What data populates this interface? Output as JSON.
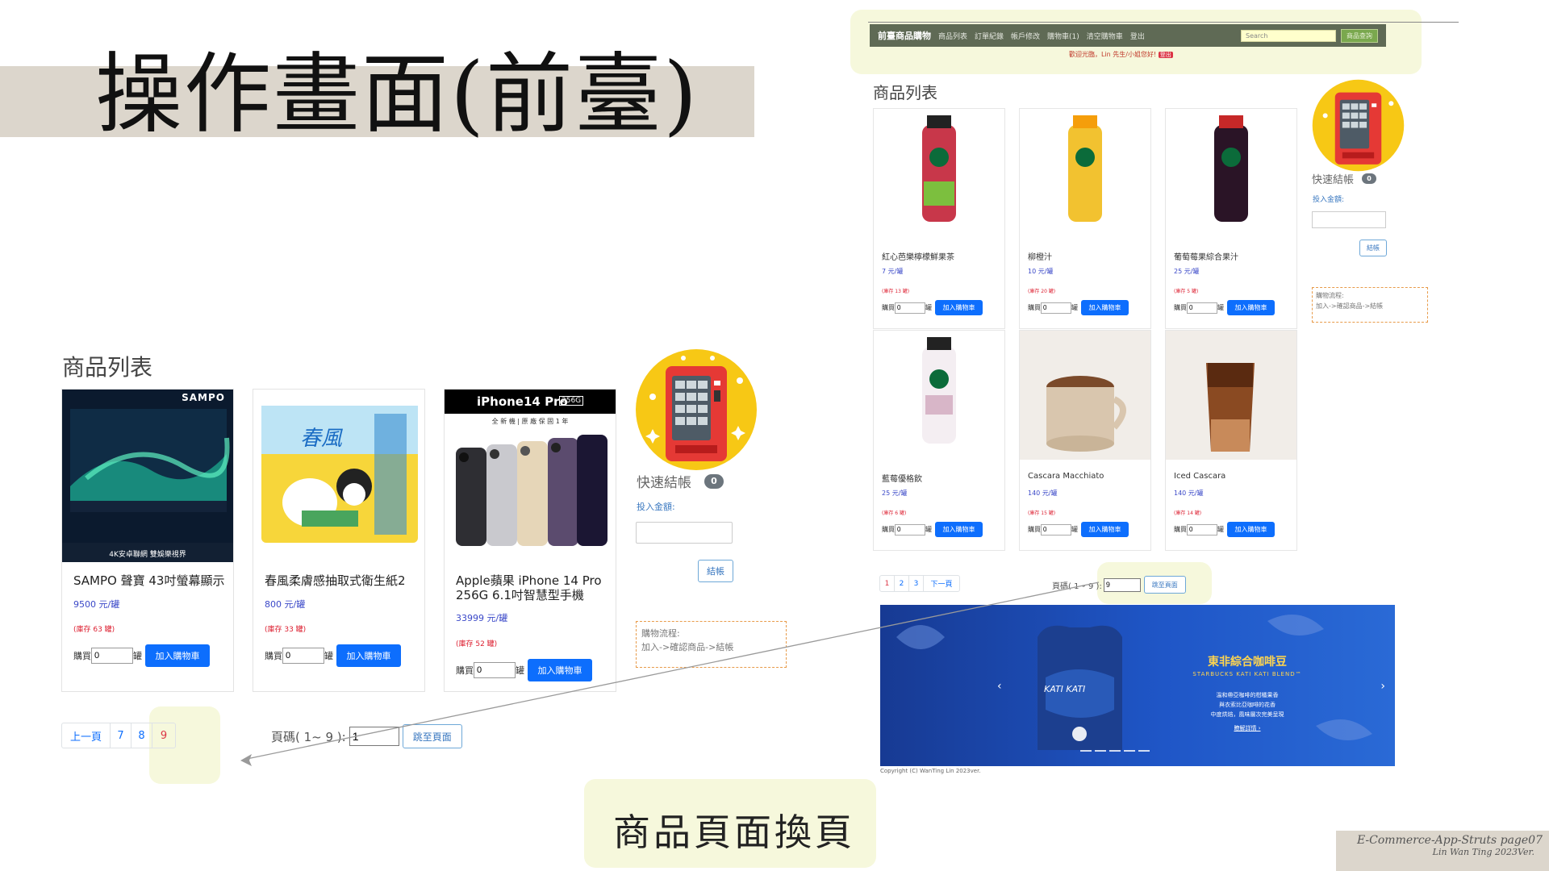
{
  "slide": {
    "title": "操作畫面(前臺)",
    "caption": "商品頁面換頁",
    "footer_line1": "E-Commerce-App-Struts page07",
    "footer_line2": "Lin Wan Ting 2023Ver."
  },
  "left_panel": {
    "section_title": "商品列表",
    "products": [
      {
        "name": "SAMPO 聲寶 43吋螢幕顯示",
        "price": "9500 元/罐",
        "stock": "(庫存 63 罐)",
        "buy_label": "購買",
        "qty": "0",
        "unit": "罐",
        "add_button": "加入購物車",
        "image_brand": "SAMPO",
        "image_caption": "4K安卓聯網 雙娛樂視界"
      },
      {
        "name": "春風柔膚感抽取式衛生紙2",
        "price": "800 元/罐",
        "stock": "(庫存 33 罐)",
        "buy_label": "購買",
        "qty": "0",
        "unit": "罐",
        "add_button": "加入購物車",
        "image_brand": "春風"
      },
      {
        "name": "Apple蘋果 iPhone 14 Pro 256G 6.1吋智慧型手機",
        "price": "33999 元/罐",
        "stock": "(庫存 52 罐)",
        "buy_label": "購買",
        "qty": "0",
        "unit": "罐",
        "add_button": "加入購物車",
        "image_brand": "iPhone14 Pro",
        "image_badge": "256G",
        "image_caption": "全 新 機 | 原 廠 保 固 1 年"
      }
    ],
    "quick_checkout": {
      "title": "快速結帳",
      "badge": "0",
      "amount_label": "投入金額:",
      "amount_value": "",
      "checkout_button": "結帳"
    },
    "flow": {
      "label": "購物流程:",
      "steps": "加入->確認商品->結帳"
    },
    "pagination": {
      "prev": "上一頁",
      "pages": [
        "7",
        "8",
        "9"
      ],
      "active": "9"
    },
    "jump": {
      "label": "頁碼( 1~ 9 ):",
      "value": "1",
      "button": "跳至頁面"
    }
  },
  "right_panel": {
    "navbar": {
      "brand": "前臺商品購物",
      "items": [
        "商品列表",
        "訂單紀錄",
        "帳戶修改",
        "購物車(1)",
        "清空購物車",
        "登出"
      ],
      "search_placeholder": "Search",
      "search_button": "商品查詢"
    },
    "welcome": "歡迎光臨，Lin 先生/小姐您好!",
    "logout": "登出",
    "section_title": "商品列表",
    "products": [
      {
        "name": "紅心芭樂檸檬鮮果茶",
        "price": "7 元/罐",
        "stock": "(庫存 13 罐)",
        "buy_label": "購買",
        "qty": "0",
        "unit": "罐",
        "add_button": "加入購物車"
      },
      {
        "name": "柳橙汁",
        "price": "10 元/罐",
        "stock": "(庫存 20 罐)",
        "buy_label": "購買",
        "qty": "0",
        "unit": "罐",
        "add_button": "加入購物車"
      },
      {
        "name": "葡萄莓果綜合果汁",
        "price": "25 元/罐",
        "stock": "(庫存 5 罐)",
        "buy_label": "購買",
        "qty": "0",
        "unit": "罐",
        "add_button": "加入購物車"
      },
      {
        "name": "藍莓優格飲",
        "price": "25 元/罐",
        "stock": "(庫存 6 罐)",
        "buy_label": "購買",
        "qty": "0",
        "unit": "罐",
        "add_button": "加入購物車"
      },
      {
        "name": "Cascara Macchiato",
        "price": "140 元/罐",
        "stock": "(庫存 15 罐)",
        "buy_label": "購買",
        "qty": "0",
        "unit": "罐",
        "add_button": "加入購物車"
      },
      {
        "name": "Iced Cascara",
        "price": "140 元/罐",
        "stock": "(庫存 14 罐)",
        "buy_label": "購買",
        "qty": "0",
        "unit": "罐",
        "add_button": "加入購物車"
      }
    ],
    "quick_checkout": {
      "title": "快速結帳",
      "badge": "0",
      "amount_label": "投入金額:",
      "checkout_button": "結帳"
    },
    "flow": {
      "label": "購物流程:",
      "steps": "加入->確認商品->結帳"
    },
    "pagination": {
      "pages": [
        "1",
        "2",
        "3"
      ],
      "active": "1",
      "next": "下一頁"
    },
    "jump": {
      "label": "頁碼( 1~ 9 ):",
      "value": "9",
      "button": "跳至頁面"
    },
    "banner": {
      "title": "東非綜合咖啡豆",
      "subtitle": "STARBUCKS KATI KATI BLEND™",
      "line1": "溫和帶亞咖啡的柑橘果香",
      "line2": "與衣索比亞咖啡的花香",
      "line3": "中度烘焙，風味層次完美呈現",
      "more": "瞭解詳情 ›",
      "bag_text": "KATI KATI"
    },
    "copyright": "Copyright (C) WanTing Lin 2023ver."
  },
  "colors": {
    "accent_blue": "#0d6efd",
    "nav_bg": "#5f6a55",
    "highlight": "#f6f8dc",
    "danger": "#dc3545",
    "price_blue": "#3a48c8"
  }
}
